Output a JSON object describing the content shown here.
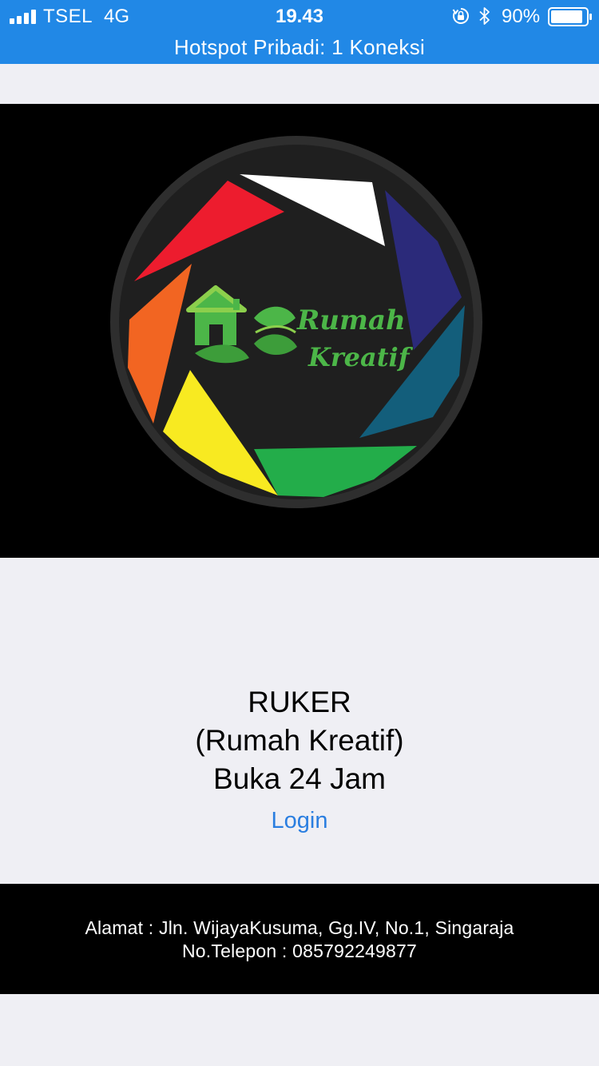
{
  "status_bar": {
    "carrier": "TSEL",
    "network": "4G",
    "time": "19.43",
    "battery_percent": "90%",
    "battery_level": 0.9,
    "signal_bars": 4,
    "hotspot_text": "Hotspot Pribadi: 1 Koneksi",
    "bar_color": "#2188e6"
  },
  "banner": {
    "logo_text_line1": "Rumah",
    "logo_text_line2": "Kreatif",
    "logo_colors": {
      "red": "#ed1c2e",
      "white": "#ffffff",
      "navy": "#2b2a7a",
      "teal": "#135e7b",
      "green": "#23ad4a",
      "yellow": "#f8ea21",
      "orange": "#f26522",
      "brand_green": "#4cb648"
    }
  },
  "info": {
    "title": "RUKER",
    "subtitle": "(Rumah Kreatif)",
    "hours": "Buka 24 Jam",
    "login_label": "Login",
    "link_color": "#2a7ee0"
  },
  "footer": {
    "address": "Alamat : Jln. WijayaKusuma, Gg.IV, No.1, Singaraja",
    "phone": "No.Telepon : 085792249877"
  }
}
